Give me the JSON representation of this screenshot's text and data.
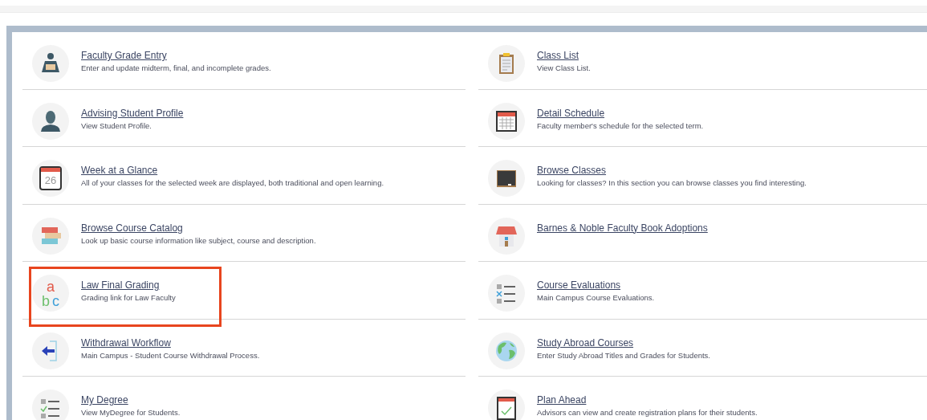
{
  "left_column": [
    {
      "kind": "reader",
      "title": "Faculty Grade Entry",
      "description": "Enter and update midterm, final, and incomplete grades.",
      "highlighted": false
    },
    {
      "kind": "person",
      "title": "Advising Student Profile",
      "description": "View Student Profile.",
      "highlighted": false
    },
    {
      "kind": "calendar",
      "icon_text": "26",
      "title": "Week at a Glance",
      "description": "All of your classes for the selected week are displayed, both traditional and open learning.",
      "highlighted": false
    },
    {
      "kind": "books",
      "title": "Browse Course Catalog",
      "description": "Look up basic course information like subject, course and description.",
      "highlighted": false
    },
    {
      "kind": "letters",
      "icon_letters": [
        "a",
        "b",
        "c"
      ],
      "title": "Law Final Grading",
      "description": "Grading link for Law Faculty",
      "highlighted": true
    },
    {
      "kind": "exit",
      "title": "Withdrawal Workflow",
      "description": "Main Campus - Student Course Withdrawal Process.",
      "highlighted": false
    },
    {
      "kind": "checklist",
      "title": "My Degree",
      "description": "View MyDegree for Students.",
      "highlighted": false
    }
  ],
  "right_column": [
    {
      "kind": "clipboard",
      "title": "Class List",
      "description": "View Class List.",
      "highlighted": false
    },
    {
      "kind": "schedule",
      "title": "Detail Schedule",
      "description": "Faculty member's schedule for the selected term.",
      "highlighted": false
    },
    {
      "kind": "chalkboard",
      "title": "Browse Classes",
      "description": "Looking for classes? In this section you can browse classes you find interesting.",
      "highlighted": false
    },
    {
      "kind": "store",
      "title": "Barnes & Noble Faculty Book Adoptions",
      "highlighted": false
    },
    {
      "kind": "checklist-x",
      "title": "Course Evaluations",
      "description": "Main Campus Course Evaluations.",
      "highlighted": false
    },
    {
      "kind": "globe",
      "title": "Study Abroad Courses",
      "description": "Enter Study Abroad Titles and Grades for Students.",
      "highlighted": false
    },
    {
      "kind": "tablet-check",
      "title": "Plan Ahead",
      "description": "Advisors can view and create registration plans for their students.",
      "highlighted": false
    }
  ]
}
